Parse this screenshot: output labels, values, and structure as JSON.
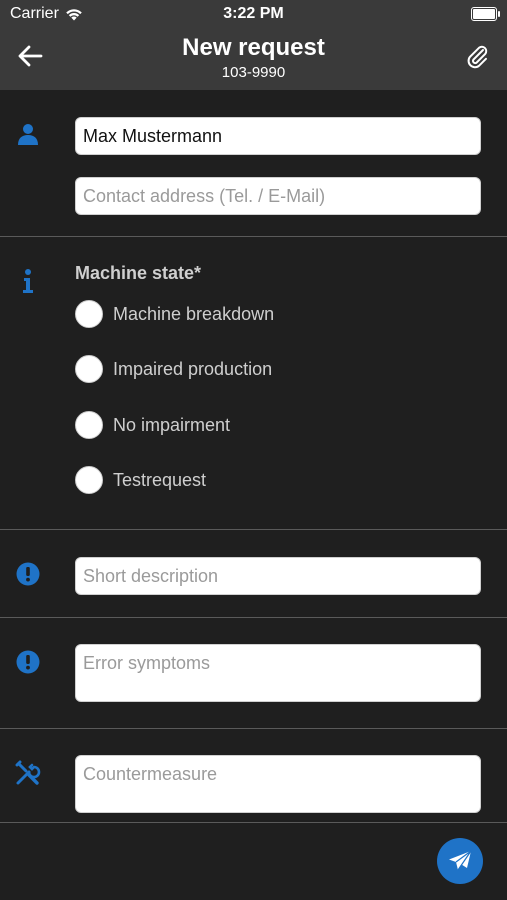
{
  "status_bar": {
    "carrier": "Carrier",
    "time": "3:22 PM",
    "icons": [
      "wifi-icon",
      "battery-icon"
    ]
  },
  "nav": {
    "title": "New request",
    "subtitle": "103-9990",
    "back_icon": "arrow-left-icon",
    "attach_icon": "paperclip-icon"
  },
  "contact": {
    "icon": "person-icon",
    "name_value": "Max Mustermann",
    "address_placeholder": "Contact address (Tel. / E-Mail)"
  },
  "machine_state": {
    "icon": "info-icon",
    "label": "Machine state*",
    "options": [
      {
        "label": "Machine breakdown",
        "selected": false
      },
      {
        "label": "Impaired production",
        "selected": false
      },
      {
        "label": "No impairment",
        "selected": false
      },
      {
        "label": "Testrequest",
        "selected": false
      }
    ]
  },
  "short_description": {
    "icon": "exclamation-circle-icon",
    "placeholder": "Short description"
  },
  "error_symptoms": {
    "icon": "exclamation-circle-icon",
    "placeholder": "Error symptoms"
  },
  "countermeasure": {
    "icon": "wrench-screwdriver-icon",
    "placeholder": "Countermeasure"
  },
  "send_button": {
    "icon": "paper-plane-icon"
  },
  "colors": {
    "accent": "#1f73c7",
    "background": "#1f1f1f",
    "navbar": "#3a3a3a"
  }
}
